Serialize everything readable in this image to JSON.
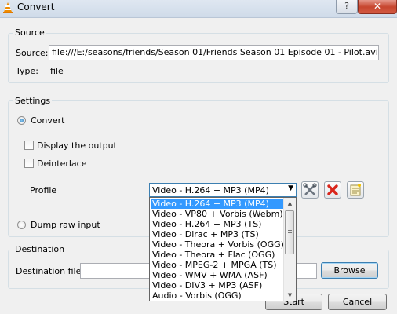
{
  "window": {
    "title": "Convert",
    "help": "?",
    "close": "✕"
  },
  "source": {
    "group_label": "Source",
    "source_label": "Source:",
    "source_value": "file:///E:/seasons/friends/Season 01/Friends Season 01 Episode 01 - Pilot.avi",
    "type_label": "Type:",
    "type_value": "file"
  },
  "settings": {
    "group_label": "Settings",
    "convert_label": "Convert",
    "display_output_label": "Display the output",
    "deinterlace_label": "Deinterlace",
    "profile_label": "Profile",
    "profile_selected": "Video - H.264 + MP3 (MP4)",
    "dump_raw_label": "Dump raw input",
    "profile_options": [
      "Video - H.264 + MP3 (MP4)",
      "Video - VP80 + Vorbis (Webm)",
      "Video - H.264 + MP3 (TS)",
      "Video - Dirac + MP3 (TS)",
      "Video - Theora + Vorbis (OGG)",
      "Video - Theora + Flac (OGG)",
      "Video - MPEG-2 + MPGA (TS)",
      "Video - WMV + WMA (ASF)",
      "Video - DIV3 + MP3 (ASF)",
      "Audio - Vorbis (OGG)"
    ]
  },
  "destination": {
    "group_label": "Destination",
    "file_label": "Destination file:",
    "file_value": "",
    "browse_label": "Browse"
  },
  "footer": {
    "start_label": "Start",
    "cancel_label": "Cancel"
  },
  "colors": {
    "selection": "#3399ff",
    "close": "#c7462f",
    "delete": "#d9261c"
  }
}
